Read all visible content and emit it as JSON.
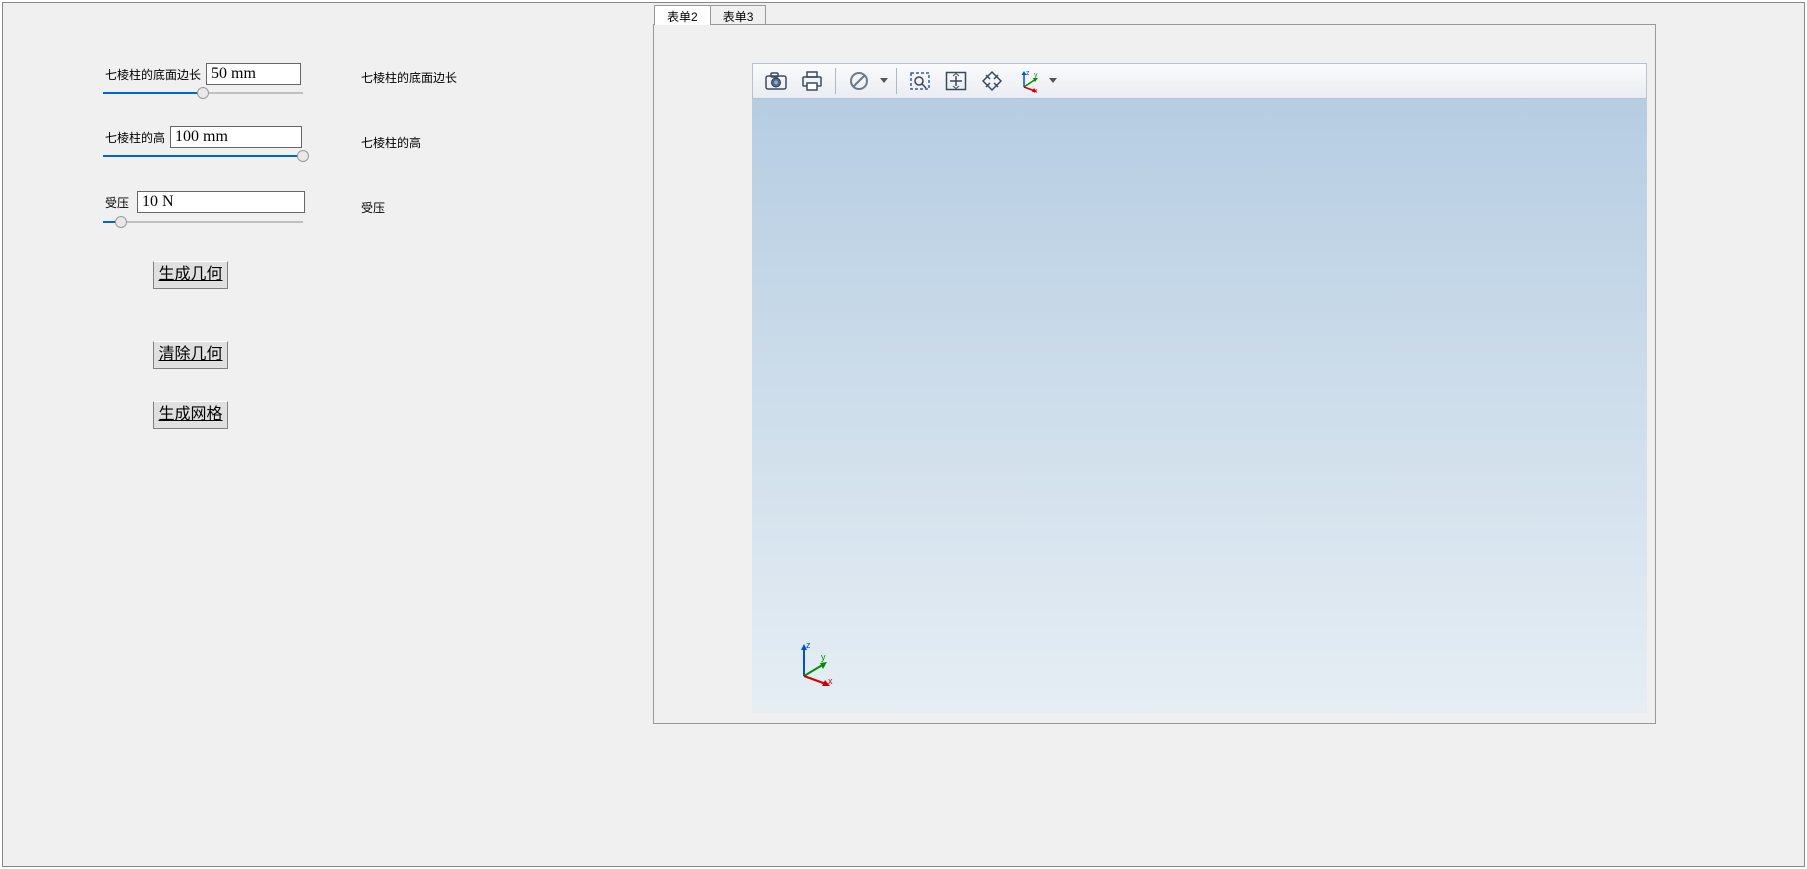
{
  "params": {
    "base_edge": {
      "label": "七棱柱的底面边长",
      "value": "50 mm",
      "desc": "七棱柱的底面边长"
    },
    "height": {
      "label": "七棱柱的高",
      "value": "100 mm",
      "desc": "七棱柱的高"
    },
    "pressure": {
      "label": "受压",
      "value": "10 N",
      "desc": "受压"
    }
  },
  "buttons": {
    "gen_geom": "生成几何",
    "clear_geom": "清除几何",
    "gen_mesh": "生成网格"
  },
  "tabs": {
    "t2": "表单2",
    "t3": "表单3"
  },
  "toolbar": {
    "camera": "camera-icon",
    "print": "print-icon",
    "cancel": "cancel-icon",
    "zoom_select": "zoom-select-icon",
    "fit": "fit-view-icon",
    "spread": "spread-icon",
    "axes": "axes-orientation-icon"
  },
  "axis_labels": {
    "x": "x",
    "y": "y",
    "z": "z"
  }
}
